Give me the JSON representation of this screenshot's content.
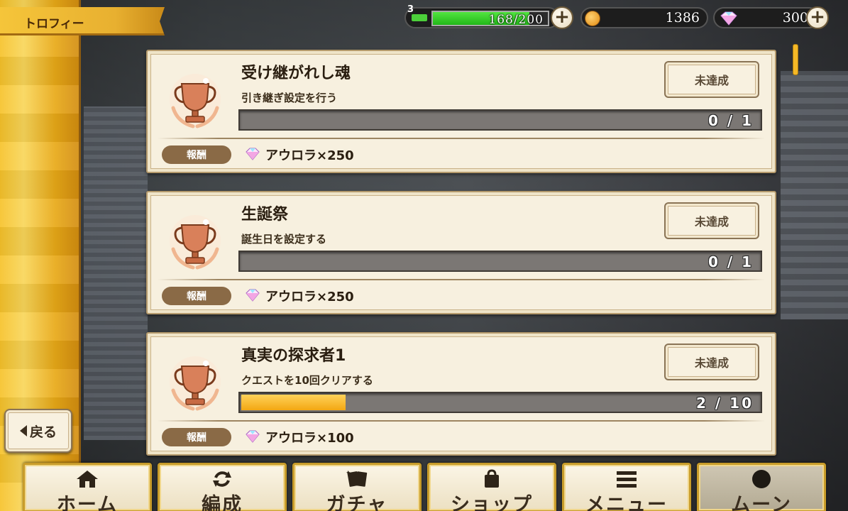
{
  "header": {
    "title": "トロフィー"
  },
  "status": {
    "stamina_level": "3",
    "stamina_text": "168/200",
    "stamina_fraction": 0.84,
    "coins": "1386",
    "gems": "300"
  },
  "trophies": [
    {
      "title": "受け継がれし魂",
      "description": "引き継ぎ設定を行う",
      "status": "未達成",
      "progress_text": "0 / 1",
      "progress_fraction": 0,
      "reward_label": "報酬",
      "reward_text": "アウロラ×250"
    },
    {
      "title": "生誕祭",
      "description": "誕生日を設定する",
      "status": "未達成",
      "progress_text": "0 / 1",
      "progress_fraction": 0,
      "reward_label": "報酬",
      "reward_text": "アウロラ×250"
    },
    {
      "title": "真実の探求者1",
      "description": "クエストを10回クリアする",
      "status": "未達成",
      "progress_text": "2 / 10",
      "progress_fraction": 0.2,
      "reward_label": "報酬",
      "reward_text": "アウロラ×100"
    }
  ],
  "back_button": {
    "label": "戻る"
  },
  "nav": [
    {
      "label": "ホーム",
      "icon": "home-icon"
    },
    {
      "label": "編成",
      "icon": "refresh-icon"
    },
    {
      "label": "ガチャ",
      "icon": "cards-icon"
    },
    {
      "label": "ショップ",
      "icon": "bag-icon"
    },
    {
      "label": "メニュー",
      "icon": "menu-icon"
    },
    {
      "label": "ムーン",
      "icon": "moon-icon"
    }
  ],
  "colors": {
    "accent_gold": "#f5c53a",
    "card_bg": "#f7f0df",
    "progress_fill": "#f3a712",
    "stamina_fill": "#22b818"
  }
}
